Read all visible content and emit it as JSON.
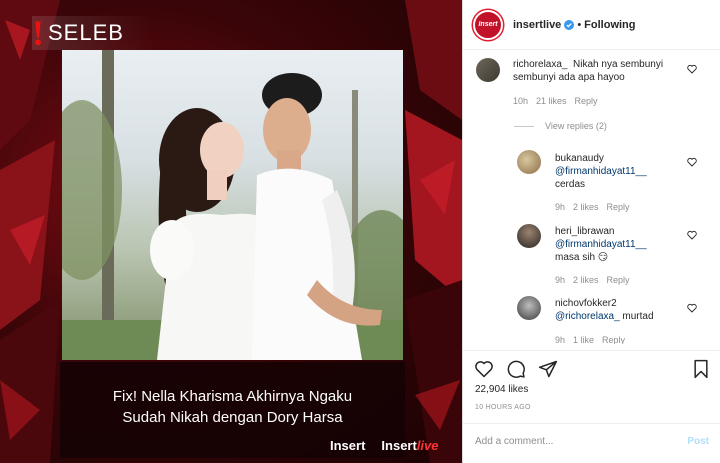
{
  "media": {
    "brand_mark": "!",
    "brand_label": "SELEB",
    "caption_line1": "Fix! Nella Kharisma Akhirnya Ngaku",
    "caption_line2": "Sudah Nikah dengan Dory Harsa",
    "logo_left": "Insert",
    "logo_right_main": "Insert",
    "logo_right_live": "live"
  },
  "post_header": {
    "username": "insertlive",
    "separator": "•",
    "follow_label": "Following",
    "avatar_text": "Insert"
  },
  "comments": [
    {
      "user": "richorelaxa_",
      "text_before_mention": "Nikah nya sembunyi sembunyi ada apa hayoo",
      "time": "10h",
      "likes": "21 likes",
      "reply": "Reply",
      "view_replies": "View replies (2)"
    },
    {
      "user": "bukanaudy",
      "mention": "@firmanhidayat11__",
      "text": "cerdas",
      "time": "9h",
      "likes": "2 likes",
      "reply": "Reply"
    },
    {
      "user": "heri_librawan",
      "mention": "@firmanhidayat11__",
      "text": "masa sih 😏",
      "time": "9h",
      "likes": "2 likes",
      "reply": "Reply"
    },
    {
      "user": "nichovfokker2",
      "mention": "@richorelaxa_",
      "text": "murtad",
      "time": "9h",
      "likes": "1 like",
      "reply": "Reply"
    }
  ],
  "actions": {
    "likes_count": "22,904 likes",
    "timestamp": "10 HOURS AGO",
    "add_comment_placeholder": "Add a comment...",
    "post_label": "Post"
  },
  "colors": {
    "accent_red": "#e11d2f",
    "link_blue": "#00376b",
    "post_disabled": "#b2dffc",
    "verified_blue": "#3897f0"
  },
  "icons": [
    "verified-icon",
    "heart-icon",
    "comment-icon",
    "share-icon",
    "bookmark-icon"
  ]
}
